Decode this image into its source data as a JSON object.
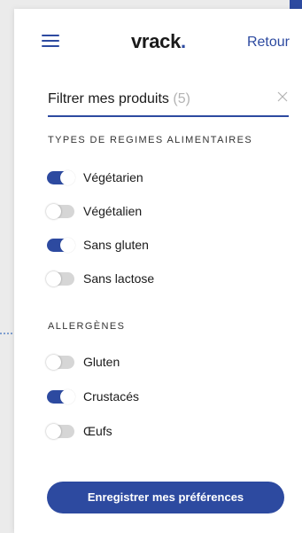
{
  "header": {
    "logo_text": "vrack",
    "logo_dot": ".",
    "back_label": "Retour"
  },
  "filter": {
    "label": "Filtrer mes produits",
    "count": "(5)"
  },
  "diet_section": {
    "title": "TYPES DE REGIMES ALIMENTAIRES",
    "options": [
      {
        "label": "Végétarien",
        "enabled": true
      },
      {
        "label": "Végétalien",
        "enabled": false
      },
      {
        "label": "Sans gluten",
        "enabled": true
      },
      {
        "label": "Sans lactose",
        "enabled": false
      }
    ]
  },
  "allergen_section": {
    "title": "ALLERGÈNES",
    "options": [
      {
        "label": "Gluten",
        "enabled": false
      },
      {
        "label": "Crustacés",
        "enabled": true
      },
      {
        "label": "Œufs",
        "enabled": false
      }
    ]
  },
  "save_button": {
    "label": "Enregistrer mes préférences"
  },
  "colors": {
    "accent": "#2d4aa0",
    "toggle_off": "#d6d6d6"
  },
  "icons": {
    "menu": "hamburger-menu-icon",
    "clear": "close-icon"
  }
}
